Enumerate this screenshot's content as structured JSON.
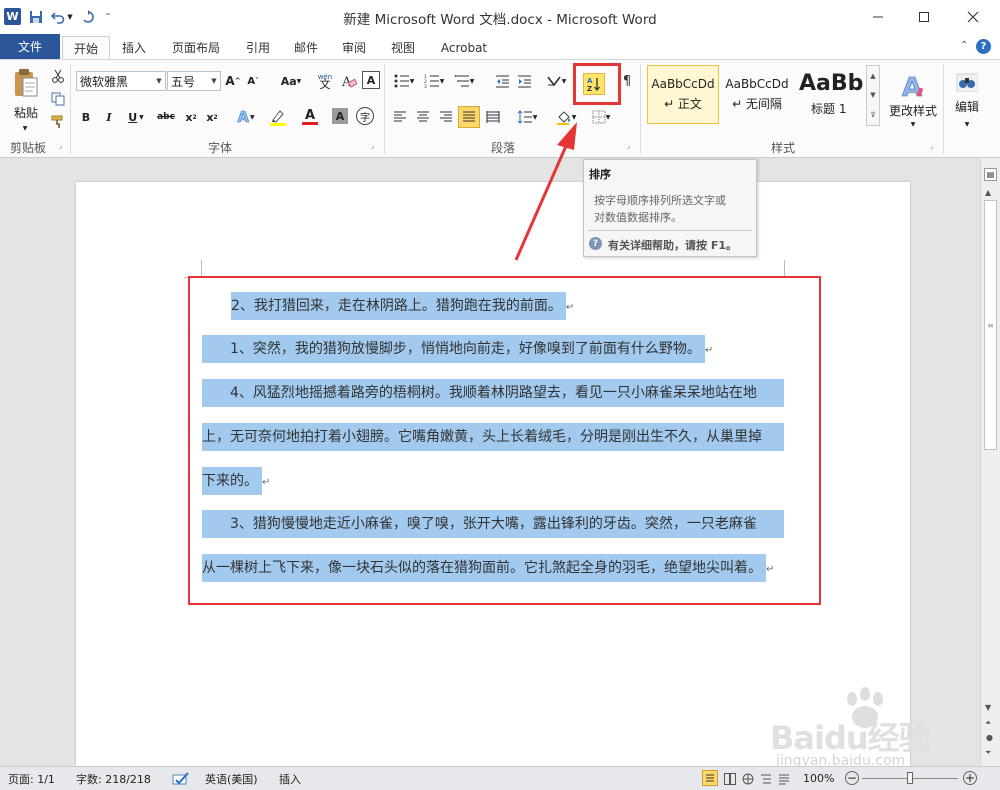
{
  "window": {
    "title": "新建 Microsoft Word 文档.docx - Microsoft Word"
  },
  "tabs": [
    "文件",
    "开始",
    "插入",
    "页面布局",
    "引用",
    "邮件",
    "审阅",
    "视图",
    "Acrobat"
  ],
  "clipboard": {
    "paste_label": "粘贴",
    "group_label": "剪贴板"
  },
  "font": {
    "name": "微软雅黑",
    "size": "五号",
    "group_label": "字体",
    "grow_label": "A",
    "shrink_label": "A",
    "case_label": "Aa",
    "wen_label": "wén",
    "clear_label": "A",
    "bold_label": "B",
    "italic_label": "I",
    "underline_label": "U",
    "strike_label": "abc",
    "sub_label": "x",
    "sup_label": "x",
    "effects_label": "A",
    "color_label": "A",
    "charshade_label": "A",
    "enclose_label": "字"
  },
  "paragraph": {
    "group_label": "段落",
    "sort_button_label": "A↓Z"
  },
  "styles": {
    "group_label": "样式",
    "items": [
      {
        "preview": "AaBbCcDd",
        "name": "↵ 正文"
      },
      {
        "preview": "AaBbCcDd",
        "name": "↵ 无间隔"
      },
      {
        "preview": "AaBb",
        "name": "标题 1"
      }
    ],
    "change_label": "更改样式"
  },
  "editing": {
    "label": "编辑"
  },
  "tooltip": {
    "title": "排序",
    "line1": "按字母顺序排列所选文字或",
    "line2": "对数值数据排序。",
    "help": "有关详细帮助，请按 F1。"
  },
  "document": {
    "paragraphs": [
      {
        "lines": [
          "2、我打猎回来，走在林阴路上。猎狗跑在我的前面。"
        ]
      },
      {
        "lines": [
          "1、突然，我的猎狗放慢脚步，悄悄地向前走，好像嗅到了前面有什么野物。"
        ]
      },
      {
        "lines": [
          "4、风猛烈地摇撼着路旁的梧桐树。我顺着林阴路望去，看见一只小麻雀呆呆地站在地",
          "上，无可奈何地拍打着小翅膀。它嘴角嫩黄，头上长着绒毛，分明是刚出生不久，从巢里掉",
          "下来的。"
        ]
      },
      {
        "lines": [
          "3、猎狗慢慢地走近小麻雀，嗅了嗅，张开大嘴，露出锋利的牙齿。突然，一只老麻雀",
          "从一棵树上飞下来，像一块石头似的落在猎狗面前。它扎煞起全身的羽毛，绝望地尖叫着。"
        ]
      }
    ],
    "para_mark": "↵"
  },
  "status": {
    "page": "页面: 1/1",
    "words": "字数: 218/218",
    "language": "英语(美国)",
    "mode": "插入",
    "zoom": "100%"
  },
  "watermark": {
    "brand": "Baidu经验",
    "url": "jingyan.baidu.com"
  },
  "colors": {
    "file_tab": "#2b579a",
    "selection": "#a2c9ee",
    "annotation_red": "#e53535",
    "highlight_yellow": "#ffe36b"
  }
}
